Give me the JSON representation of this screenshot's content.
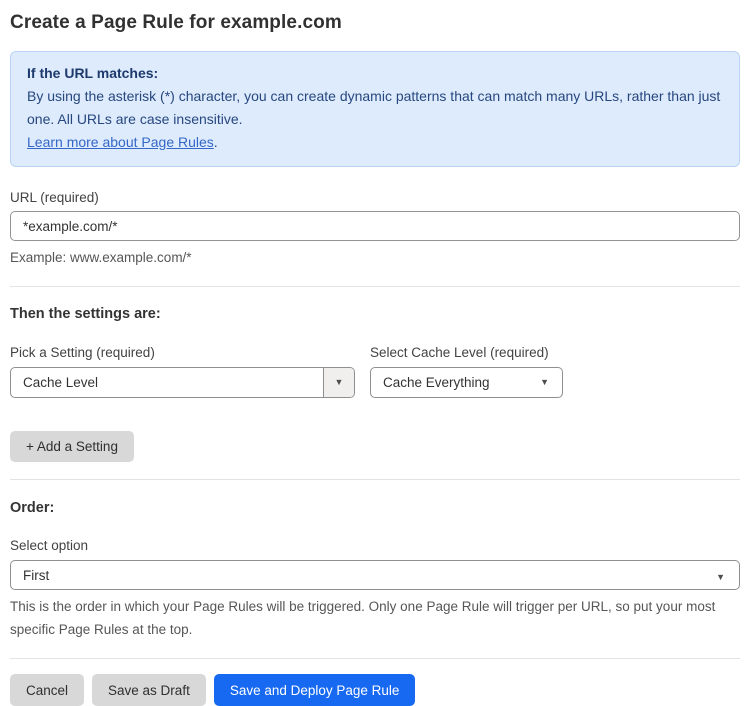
{
  "page": {
    "title": "Create a Page Rule for example.com"
  },
  "info_box": {
    "heading": "If the URL matches:",
    "body": "By using the asterisk (*) character, you can create dynamic patterns that can match many URLs, rather than just one. All URLs are case insensitive.",
    "link_label": "Learn more about Page Rules",
    "link_suffix": "."
  },
  "url_field": {
    "label": "URL (required)",
    "value": "*example.com/*",
    "helper": "Example: www.example.com/*"
  },
  "settings_section": {
    "heading": "Then the settings are:",
    "setting_picker": {
      "label": "Pick a Setting (required)",
      "value": "Cache Level"
    },
    "cache_level_picker": {
      "label": "Select Cache Level (required)",
      "value": "Cache Everything"
    },
    "add_setting_label": "+ Add a Setting"
  },
  "order_section": {
    "heading": "Order:",
    "label": "Select option",
    "value": "First",
    "helper": "This is the order in which your Page Rules will be triggered. Only one Page Rule will trigger per URL, so put your most specific Page Rules at the top."
  },
  "actions": {
    "cancel_label": "Cancel",
    "save_draft_label": "Save as Draft",
    "save_deploy_label": "Save and Deploy Page Rule"
  },
  "icons": {
    "dropdown_arrow": "▼"
  },
  "colors": {
    "accent_blue": "#1769f2",
    "info_background": "#ddebfc",
    "info_border": "#b9d5f3",
    "info_heading_text": "#1e3a6d",
    "info_body_text": "#27477f",
    "link_blue": "#3567c8",
    "button_gray": "#d8d8d8"
  }
}
